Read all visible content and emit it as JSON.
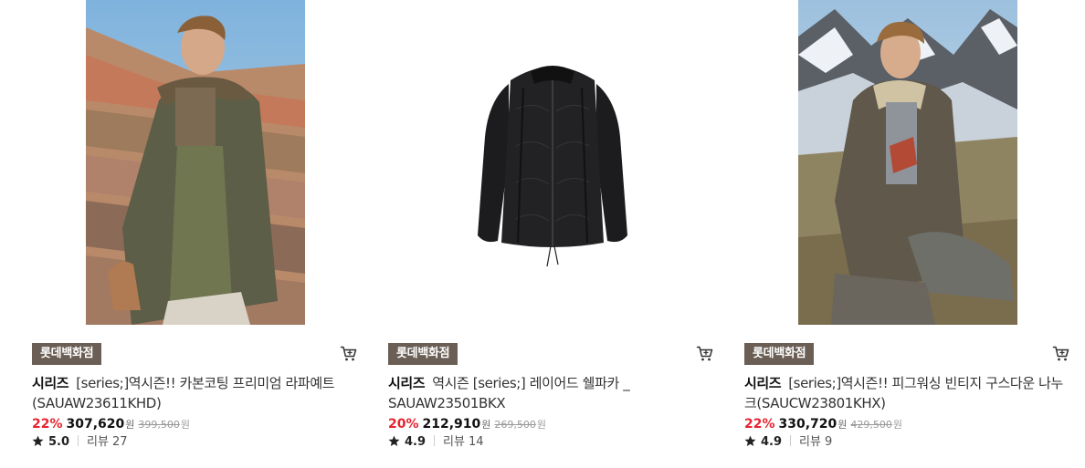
{
  "products": [
    {
      "store": "롯데백화점",
      "brand": "시리즈",
      "name": "[series;]역시즌!! 카본코팅 프리미엄 라파예트 (SAUAW23611KHD)",
      "discount": "22%",
      "price": "307,620",
      "price_unit": "원",
      "original_price": "399,500",
      "original_unit": "원",
      "rating": "5.0",
      "review_label": "리뷰",
      "review_count": "27",
      "image_icon": "model-khaki-shearling-jacket-photo"
    },
    {
      "store": "롯데백화점",
      "brand": "시리즈",
      "name": "역시즌 [series;] 레이어드 쉘파카 _ SAUAW23501BKX",
      "discount": "20%",
      "price": "212,910",
      "price_unit": "원",
      "original_price": "269,500",
      "original_unit": "원",
      "rating": "4.9",
      "review_label": "리뷰",
      "review_count": "14",
      "image_icon": "black-quilted-jacket-photo"
    },
    {
      "store": "롯데백화점",
      "brand": "시리즈",
      "name": "[series;]역시즌!! 피그워싱 빈티지 구스다운 나누크(SAUCW23801KHX)",
      "discount": "22%",
      "price": "330,720",
      "price_unit": "원",
      "original_price": "429,500",
      "original_unit": "원",
      "rating": "4.9",
      "review_label": "리뷰",
      "review_count": "9",
      "image_icon": "model-khaki-down-parka-mountain-photo"
    }
  ],
  "icons": {
    "cart": "cart-icon",
    "star": "star-icon"
  },
  "colors": {
    "store_badge_bg": "#6b5f55",
    "discount": "#e6232f",
    "price": "#111111",
    "original_price": "#999999"
  }
}
